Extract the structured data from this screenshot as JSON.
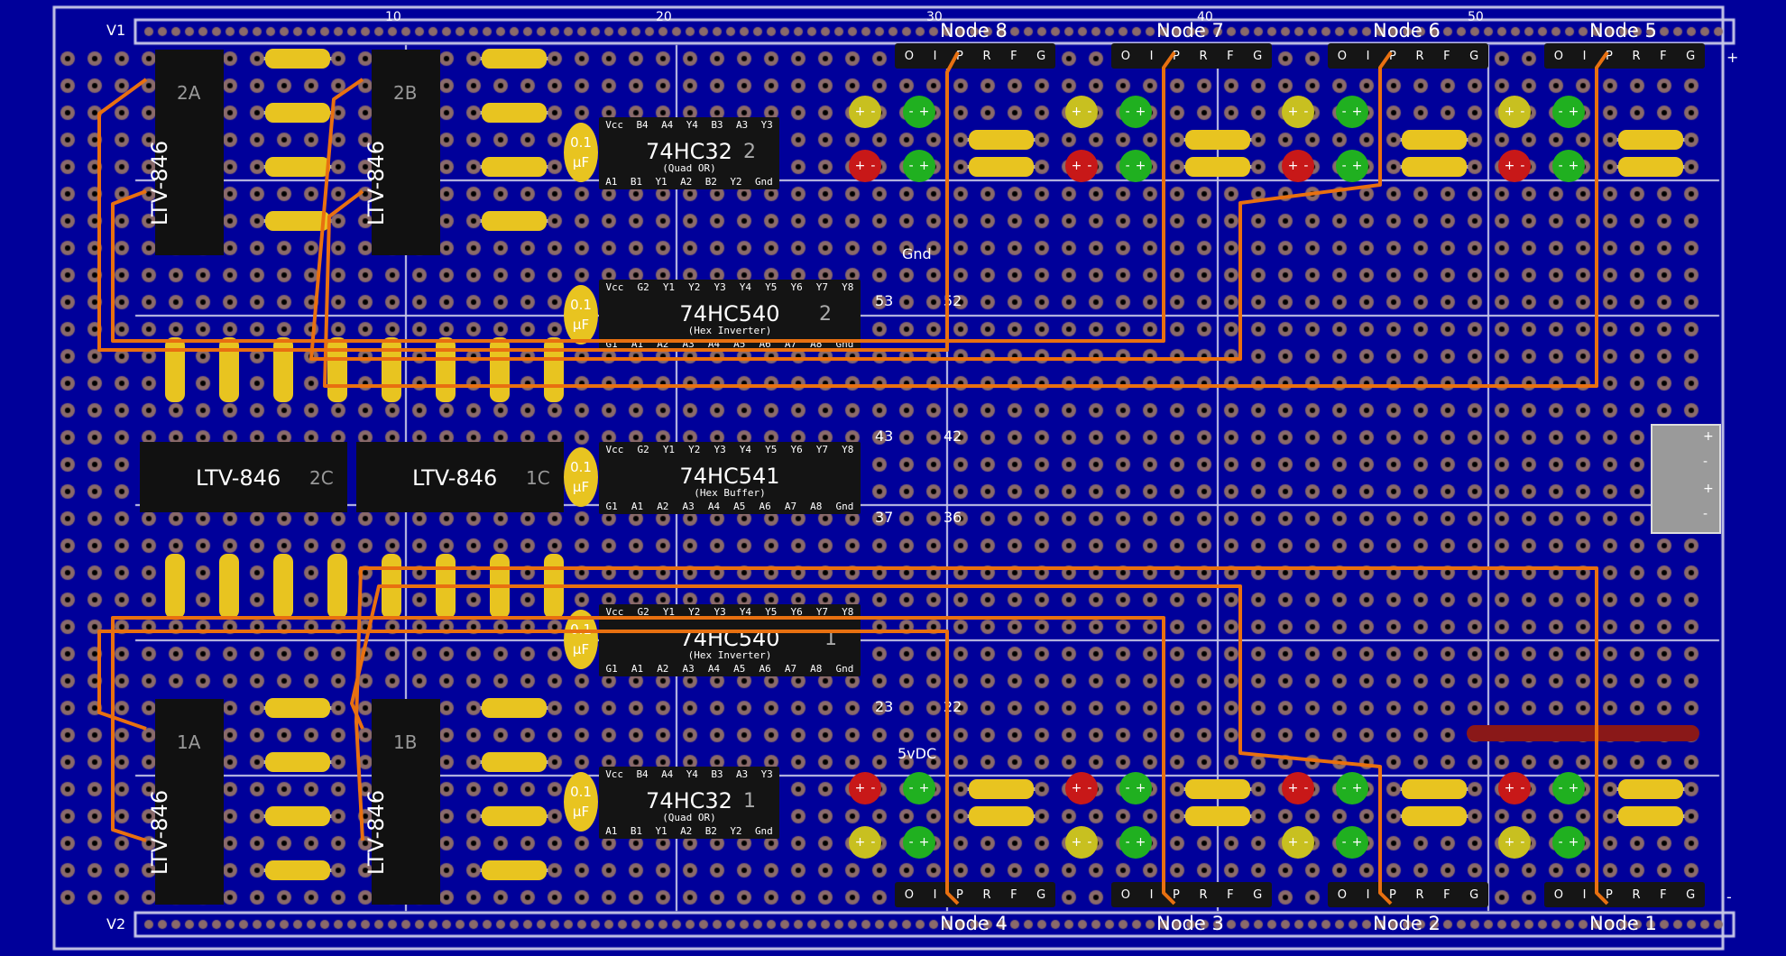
{
  "rails": {
    "top_label": "V1",
    "bottom_label": "V2",
    "plus": "+",
    "minus": "-"
  },
  "column_numbers": [
    "10",
    "20",
    "30",
    "40",
    "50"
  ],
  "nodes": {
    "top": [
      "Node 8",
      "Node 7",
      "Node 6",
      "Node 5"
    ],
    "bottom": [
      "Node 4",
      "Node 3",
      "Node 2",
      "Node 1"
    ]
  },
  "header_pins": [
    "O",
    "I",
    "P",
    "R",
    "F",
    "G"
  ],
  "pin_labels": {
    "gnd": "Gnd",
    "p53": "53",
    "p52": "52",
    "p43": "43",
    "p42": "42",
    "p37": "37",
    "p36": "36",
    "p23": "23",
    "p22": "22",
    "vdc": "5vDC"
  },
  "capacitor": {
    "line1": "0.1",
    "line2": "µF"
  },
  "chips": [
    {
      "name": "74HC32",
      "sub": "(Quad OR)",
      "index": "2",
      "top_pins": [
        "Vcc",
        "B4",
        "A4",
        "Y4",
        "B3",
        "A3",
        "Y3"
      ],
      "bottom_pins": [
        "A1",
        "B1",
        "Y1",
        "A2",
        "B2",
        "Y2",
        "Gnd"
      ]
    },
    {
      "name": "74HC540",
      "sub": "(Hex Inverter)",
      "index": "2",
      "top_pins": [
        "Vcc",
        "G2",
        "Y1",
        "Y2",
        "Y3",
        "Y4",
        "Y5",
        "Y6",
        "Y7",
        "Y8"
      ],
      "bottom_pins": [
        "G1",
        "A1",
        "A2",
        "A3",
        "A4",
        "A5",
        "A6",
        "A7",
        "A8",
        "Gnd"
      ]
    },
    {
      "name": "74HC541",
      "sub": "(Hex Buffer)",
      "index": "",
      "top_pins": [
        "Vcc",
        "G2",
        "Y1",
        "Y2",
        "Y3",
        "Y4",
        "Y5",
        "Y6",
        "Y7",
        "Y8"
      ],
      "bottom_pins": [
        "G1",
        "A1",
        "A2",
        "A3",
        "A4",
        "A5",
        "A6",
        "A7",
        "A8",
        "Gnd"
      ]
    },
    {
      "name": "74HC540",
      "sub": "(Hex Inverter)",
      "index": "1",
      "top_pins": [
        "Vcc",
        "G2",
        "Y1",
        "Y2",
        "Y3",
        "Y4",
        "Y5",
        "Y6",
        "Y7",
        "Y8"
      ],
      "bottom_pins": [
        "G1",
        "A1",
        "A2",
        "A3",
        "A4",
        "A5",
        "A6",
        "A7",
        "A8",
        "Gnd"
      ]
    },
    {
      "name": "74HC32",
      "sub": "(Quad OR)",
      "index": "1",
      "top_pins": [
        "Vcc",
        "B4",
        "A4",
        "Y4",
        "B3",
        "A3",
        "Y3"
      ],
      "bottom_pins": [
        "A1",
        "B1",
        "Y1",
        "A2",
        "B2",
        "Y2",
        "Gnd"
      ]
    }
  ],
  "optos": [
    {
      "label": "LTV-846",
      "id": "2A"
    },
    {
      "label": "LTV-846",
      "id": "2B"
    },
    {
      "label": "LTV-846",
      "id": "2C"
    },
    {
      "label": "LTV-846",
      "id": "1C"
    },
    {
      "label": "LTV-846",
      "id": "1A"
    },
    {
      "label": "LTV-846",
      "id": "1B"
    }
  ],
  "led_signs": {
    "plus": "+",
    "minus": "-"
  },
  "colors": {
    "board": "#00009a",
    "hole": "#8a6a6a",
    "wire": "#e87010",
    "resistor": "#e8c420",
    "trace": "#c8c8e8",
    "jumper": "#8a1818"
  }
}
